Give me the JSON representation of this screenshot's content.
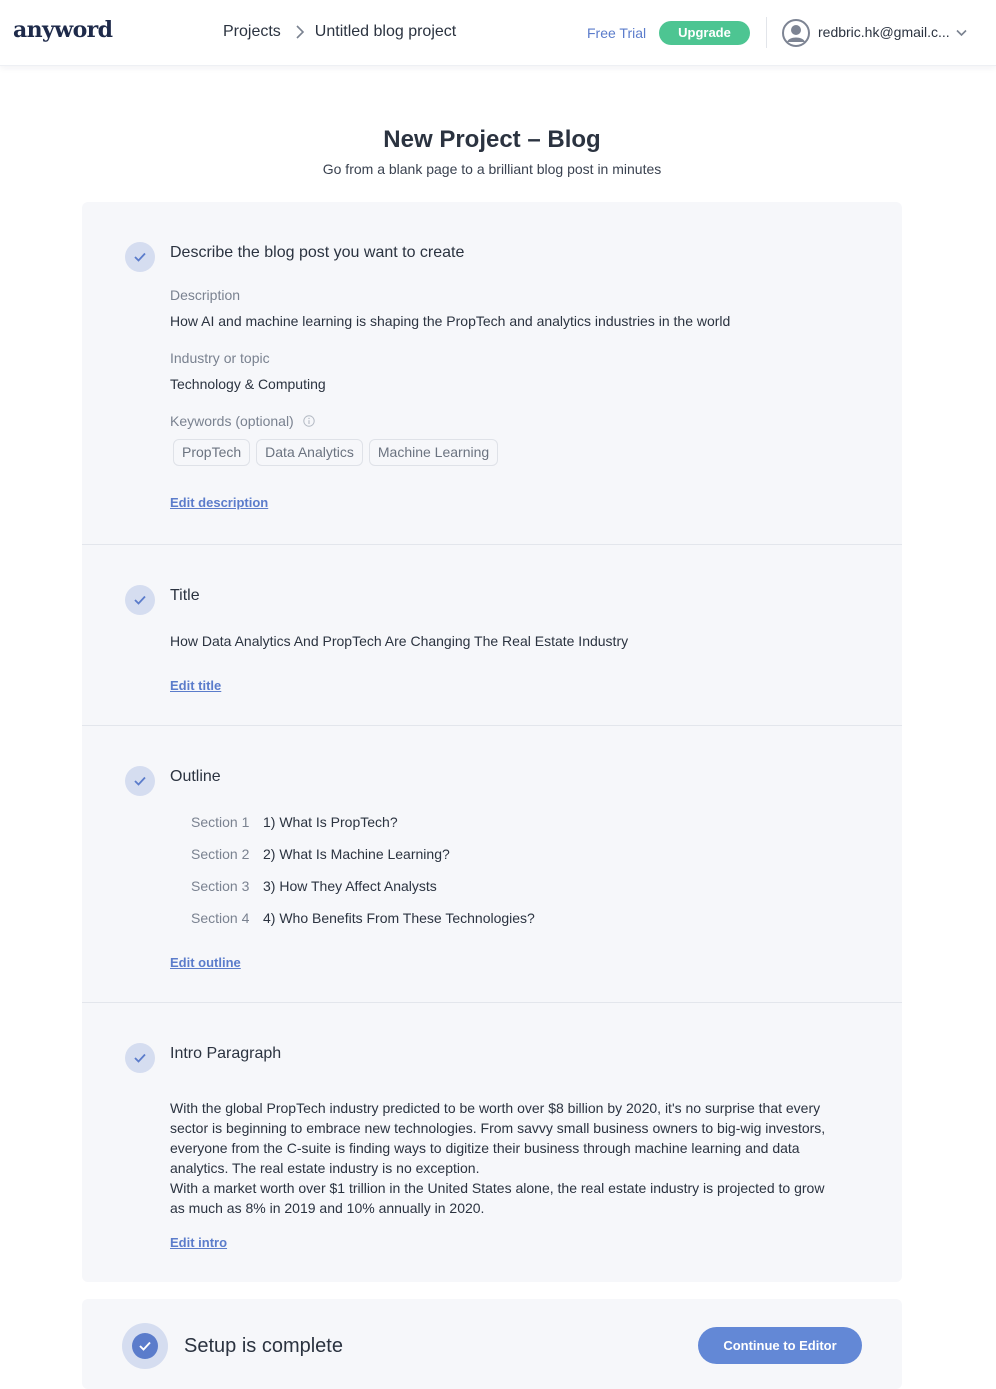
{
  "header": {
    "logo": "anyword",
    "breadcrumb_root": "Projects",
    "breadcrumb_current": "Untitled blog project",
    "free_trial": "Free Trial",
    "upgrade": "Upgrade",
    "user_email": "redbric.hk@gmail.c..."
  },
  "page": {
    "title": "New Project – Blog",
    "subtitle": "Go from a blank page to a brilliant blog post in minutes"
  },
  "describe": {
    "title": "Describe the blog post you want to create",
    "description_label": "Description",
    "description_value": "How AI and machine learning is shaping the PropTech and analytics industries in the world",
    "industry_label": "Industry or topic",
    "industry_value": "Technology & Computing",
    "keywords_label": "Keywords (optional)",
    "keywords": [
      "PropTech",
      "Data Analytics",
      "Machine Learning"
    ],
    "edit": "Edit description"
  },
  "title_section": {
    "title": "Title",
    "value": "How Data Analytics And PropTech Are Changing The Real Estate Industry",
    "edit": "Edit title"
  },
  "outline": {
    "title": "Outline",
    "sections": [
      {
        "label": "Section 1",
        "text": "1) What Is PropTech?"
      },
      {
        "label": "Section 2",
        "text": "2) What Is Machine Learning?"
      },
      {
        "label": "Section 3",
        "text": "3) How They Affect Analysts"
      },
      {
        "label": "Section 4",
        "text": "4) Who Benefits From These Technologies?"
      }
    ],
    "edit": "Edit outline"
  },
  "intro": {
    "title": "Intro Paragraph",
    "paragraph_1": "With the global PropTech industry predicted to be worth over $8 billion by 2020, it's no surprise that every sector is beginning to embrace new technologies. From savvy small business owners to big-wig investors, everyone from the C-suite is finding ways to digitize their business through machine learning and data analytics. The real estate industry is no exception.",
    "paragraph_2": "With a market worth over $1 trillion in the United States alone, the real estate industry is projected to grow as much as 8% in 2019 and 10% annually in 2020.",
    "edit": "Edit intro"
  },
  "footer": {
    "status": "Setup is complete",
    "continue": "Continue to Editor"
  },
  "colors": {
    "accent": "#5b7ccb",
    "upgrade": "#4dc592",
    "card_bg": "#f6f7fa"
  }
}
